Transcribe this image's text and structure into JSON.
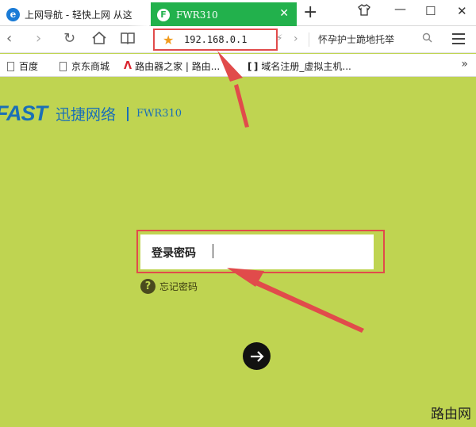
{
  "tabs": [
    {
      "title": "上网导航 - 轻快上网 从这",
      "icon": "ie-icon",
      "active": false
    },
    {
      "title": "FWR310",
      "icon": "fast-logo-icon",
      "active": true,
      "close": "✕"
    }
  ],
  "toolbar": {
    "new_tab": "+",
    "window_controls": {
      "shirt": "👕",
      "minimize": "—",
      "maximize": "☐",
      "close": "✕"
    }
  },
  "address": {
    "url": "192.168.0.1",
    "search_text": "怀孕护士跪地托举"
  },
  "bookmarks": [
    {
      "label": "百度"
    },
    {
      "label": "京东商城"
    },
    {
      "label": "路由器之家 | 路由..."
    },
    {
      "label": "域名注册_虚拟主机..."
    }
  ],
  "page": {
    "brand_logo": "FAST",
    "brand_cn": "迅捷网络",
    "model": "FWR310",
    "password_label": "登录密码",
    "forgot_password": "忘记密码",
    "watermark": "路由网"
  },
  "colors": {
    "page_bg": "#bfd451",
    "brand": "#1a6fb7",
    "tab_active": "#22b14c",
    "highlight": "#e14b4b"
  }
}
